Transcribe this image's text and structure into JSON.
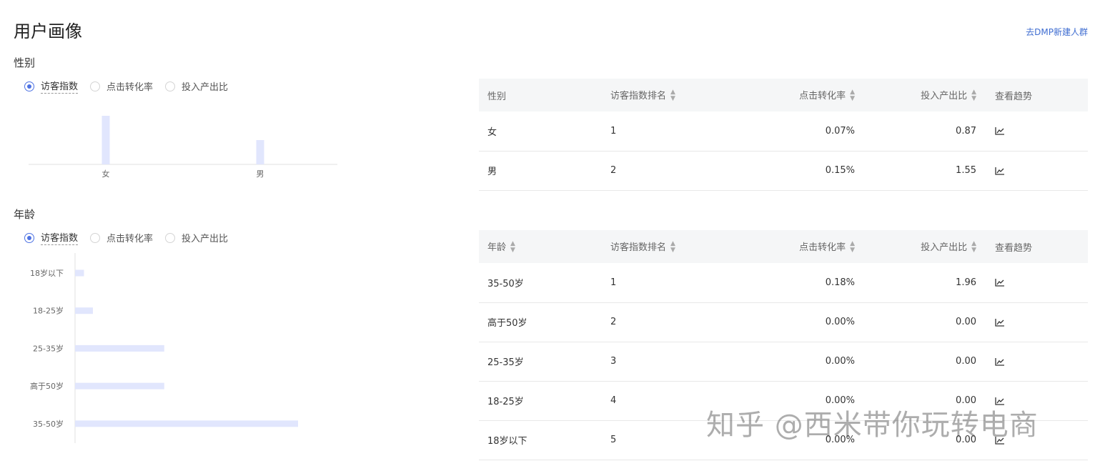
{
  "page": {
    "title": "用户画像",
    "dmp_link": "去DMP新建人群"
  },
  "gender": {
    "title": "性别",
    "radios": [
      {
        "label": "访客指数",
        "selected": true
      },
      {
        "label": "点击转化率",
        "selected": false
      },
      {
        "label": "投入产出比",
        "selected": false
      }
    ],
    "chart_data": {
      "type": "bar",
      "categories": [
        "女",
        "男"
      ],
      "values": [
        2,
        1
      ],
      "color": "#e1e6fd"
    },
    "table": {
      "headers": [
        "性别",
        "访客指数排名",
        "点击转化率",
        "投入产出比",
        "查看趋势"
      ],
      "rows": [
        {
          "name": "女",
          "rank": "1",
          "ctr": "0.07%",
          "roi": "0.87"
        },
        {
          "name": "男",
          "rank": "2",
          "ctr": "0.15%",
          "roi": "1.55"
        }
      ]
    }
  },
  "age": {
    "title": "年龄",
    "radios": [
      {
        "label": "访客指数",
        "selected": true
      },
      {
        "label": "点击转化率",
        "selected": false
      },
      {
        "label": "投入产出比",
        "selected": false
      }
    ],
    "chart_data": {
      "type": "bar",
      "orientation": "horizontal",
      "categories": [
        "18岁以下",
        "18-25岁",
        "25-35岁",
        "高于50岁",
        "35-50岁"
      ],
      "values": [
        1,
        2,
        10,
        10,
        25
      ],
      "color": "#e1e6fd"
    },
    "table": {
      "headers": [
        "年龄",
        "访客指数排名",
        "点击转化率",
        "投入产出比",
        "查看趋势"
      ],
      "rows": [
        {
          "name": "35-50岁",
          "rank": "1",
          "ctr": "0.18%",
          "roi": "1.96"
        },
        {
          "name": "高于50岁",
          "rank": "2",
          "ctr": "0.00%",
          "roi": "0.00"
        },
        {
          "name": "25-35岁",
          "rank": "3",
          "ctr": "0.00%",
          "roi": "0.00"
        },
        {
          "name": "18-25岁",
          "rank": "4",
          "ctr": "0.00%",
          "roi": "0.00"
        },
        {
          "name": "18岁以下",
          "rank": "5",
          "ctr": "0.00%",
          "roi": "0.00"
        }
      ]
    }
  },
  "watermark": "知乎 @西米带你玩转电商",
  "icons": {
    "sort": "sort-icon",
    "trend": "trend-chart-icon"
  }
}
